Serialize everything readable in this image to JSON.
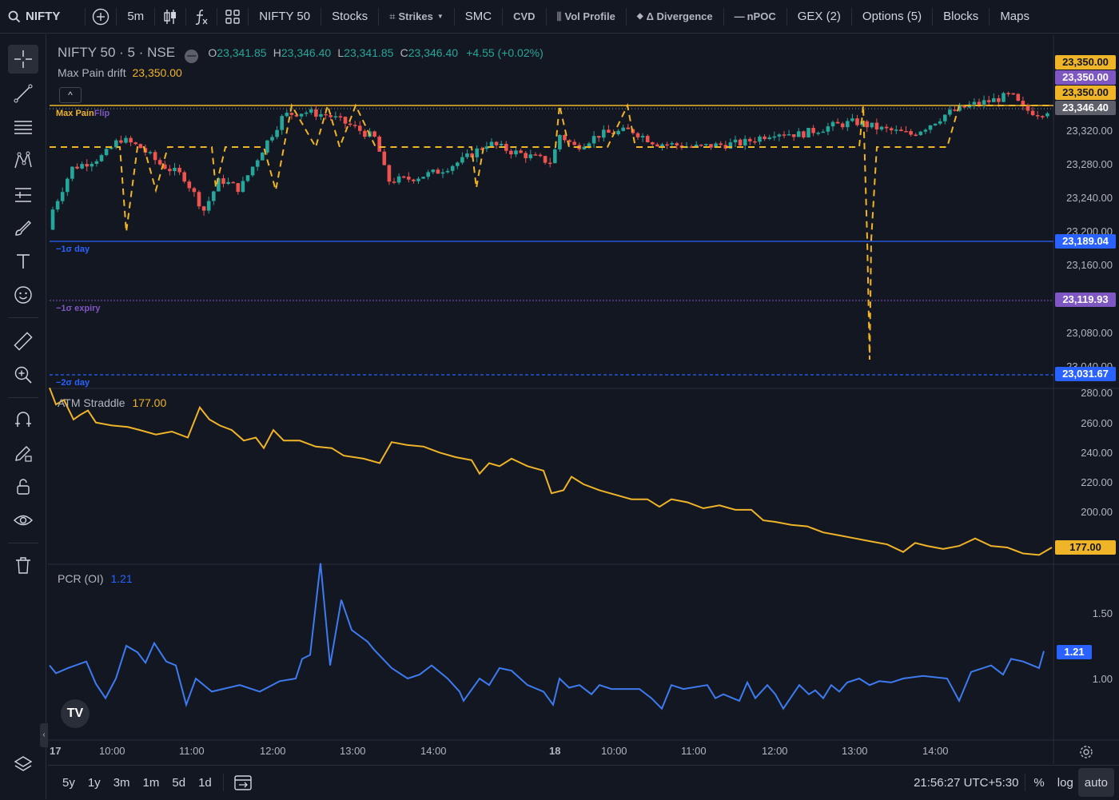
{
  "topbar": {
    "symbol": "NIFTY",
    "interval": "5m",
    "items": [
      "NIFTY 50",
      "Stocks",
      "Strikes",
      "SMC",
      "CVD",
      "Vol Profile",
      "Δ Divergence",
      "nPOC",
      "GEX (2)",
      "Options (5)",
      "Blocks",
      "Maps"
    ]
  },
  "legend": {
    "title": "NIFTY 50 · 5 · NSE",
    "o_label": "O",
    "o": "23,341.85",
    "h_label": "H",
    "h": "23,346.40",
    "l_label": "L",
    "l": "23,341.85",
    "c_label": "C",
    "c": "23,346.40",
    "change": "+4.55 (+0.02%)",
    "maxpain_label": "Max Pain drift",
    "maxpain_value": "23,350.00"
  },
  "annotations": {
    "maxpain_flip_a": "Max Pain",
    "maxpain_flip_b": "Flip",
    "sigma_day": "−1σ day",
    "sigma_expiry": "−1σ expiry",
    "sigma2_day": "−2σ day"
  },
  "price_axis": [
    "23,320.00",
    "23,280.00",
    "23,240.00",
    "23,200.00",
    "23,160.00",
    "23,080.00",
    "23,040.00"
  ],
  "price_tags": {
    "t1": "23,350.00",
    "t2": "23,350.00",
    "t3": "23,350.00",
    "t4": "23,346.40",
    "sigma_day": "23,189.04",
    "sigma_expiry": "23,119.93",
    "sigma2_day": "23,031.67"
  },
  "straddle": {
    "label": "ATM Straddle",
    "value": "177.00",
    "axis": [
      "280.00",
      "260.00",
      "240.00",
      "220.00",
      "200.00"
    ],
    "tag": "177.00"
  },
  "pcr": {
    "label": "PCR (OI)",
    "value": "1.21",
    "axis": [
      "1.50",
      "1.00"
    ],
    "tag": "1.21"
  },
  "time_axis": [
    "17",
    "10:00",
    "11:00",
    "12:00",
    "13:00",
    "14:00",
    "18",
    "10:00",
    "11:00",
    "12:00",
    "13:00",
    "14:00"
  ],
  "bottombar": {
    "ranges": [
      "5y",
      "1y",
      "3m",
      "1m",
      "5d",
      "1d"
    ],
    "clock": "21:56:27 UTC+5:30",
    "pct": "%",
    "log": "log",
    "auto": "auto"
  },
  "colors": {
    "bg": "#131722",
    "up": "#26a69a",
    "down": "#ef5350",
    "gold": "#f0b429",
    "blue": "#2962ff",
    "purple": "#7e57c2"
  }
}
